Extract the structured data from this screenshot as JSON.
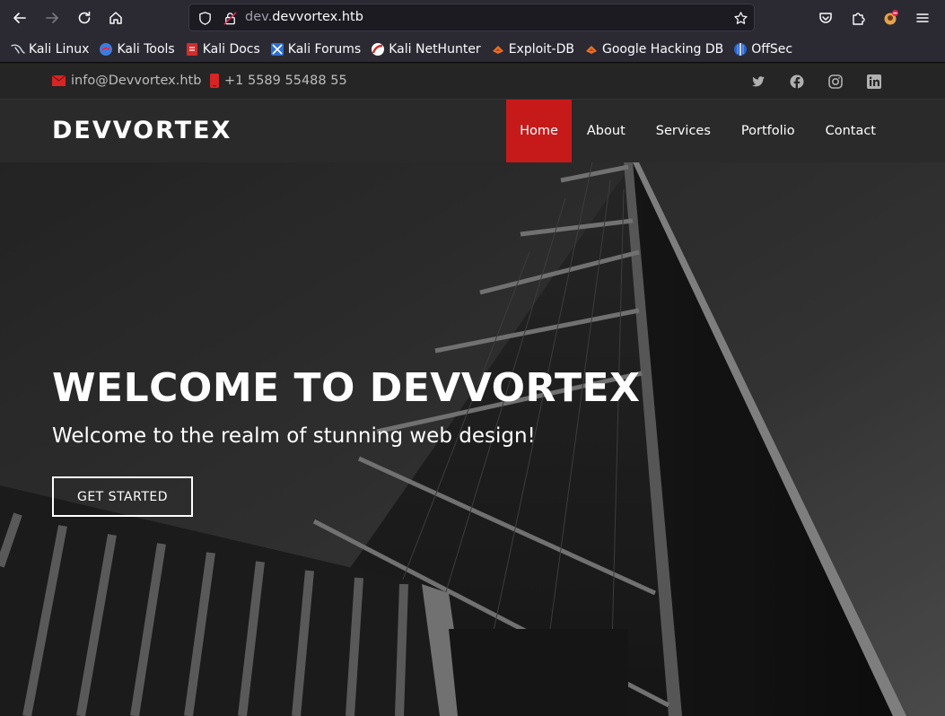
{
  "browser": {
    "url_host_prefix": "dev.",
    "url_host_main": "devvortex.htb",
    "bookmarks": [
      {
        "label": "Kali Linux",
        "icon": "kali-dragon-icon"
      },
      {
        "label": "Kali Tools",
        "icon": "kali-tools-icon"
      },
      {
        "label": "Kali Docs",
        "icon": "kali-docs-icon"
      },
      {
        "label": "Kali Forums",
        "icon": "kali-forums-icon"
      },
      {
        "label": "Kali NetHunter",
        "icon": "kali-nethunter-icon"
      },
      {
        "label": "Exploit-DB",
        "icon": "exploit-db-icon"
      },
      {
        "label": "Google Hacking DB",
        "icon": "ghdb-icon"
      },
      {
        "label": "OffSec",
        "icon": "offsec-icon"
      }
    ]
  },
  "site": {
    "email": "info@Devvortex.htb",
    "phone": "+1 5589 55488 55",
    "logo": "DEVVORTEX",
    "nav": [
      "Home",
      "About",
      "Services",
      "Portfolio",
      "Contact"
    ],
    "active_nav": "Home",
    "accent_color": "#c61a1a",
    "hero": {
      "title": "WELCOME TO DEVVORTEX",
      "subtitle": "Welcome to the realm of stunning web design!",
      "cta": "GET STARTED"
    },
    "social_icons": [
      "twitter-icon",
      "facebook-icon",
      "instagram-icon",
      "linkedin-icon"
    ]
  }
}
